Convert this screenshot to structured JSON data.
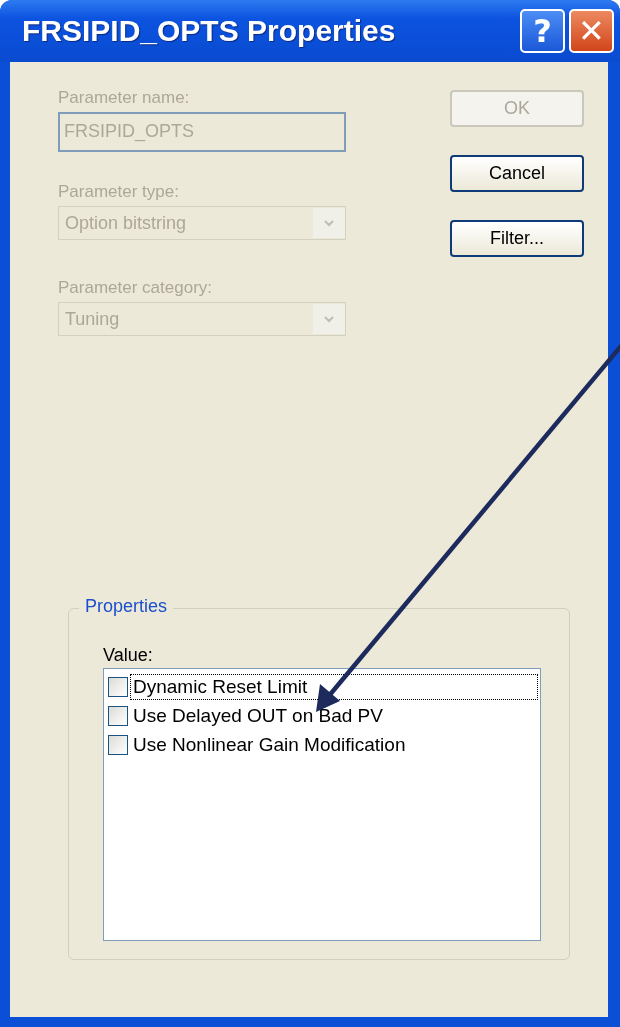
{
  "window": {
    "title": "FRSIPID_OPTS Properties",
    "controls": [
      {
        "kind": "help",
        "label": "?"
      },
      {
        "kind": "close",
        "label": "✕"
      }
    ]
  },
  "fields": [
    {
      "kind": "text",
      "label": "Parameter name:",
      "value": "FRSIPID_OPTS",
      "disabled": true
    },
    {
      "kind": "combo",
      "label": "Parameter type:",
      "value": "Option bitstring",
      "disabled": true
    },
    {
      "kind": "combo",
      "label": "Parameter category:",
      "value": "Tuning",
      "disabled": true
    }
  ],
  "buttons": [
    {
      "label": "OK",
      "disabled": true
    },
    {
      "label": "Cancel",
      "disabled": false
    },
    {
      "label": "Filter...",
      "disabled": false
    }
  ],
  "properties": {
    "title": "Properties",
    "value_label": "Value:",
    "options": [
      {
        "label": "Dynamic Reset Limit",
        "checked": false,
        "selected": true
      },
      {
        "label": "Use Delayed OUT on Bad PV",
        "checked": false,
        "selected": false
      },
      {
        "label": "Use Nonlinear Gain Modification",
        "checked": false,
        "selected": false
      }
    ]
  }
}
